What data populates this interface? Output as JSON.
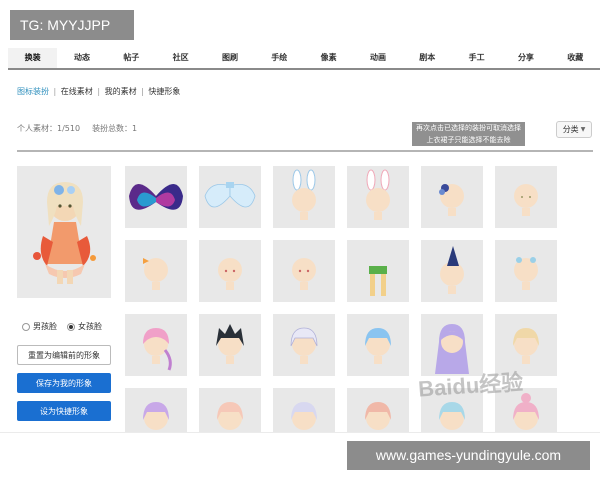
{
  "overlay": {
    "tg_label": "TG: MYYJJPP",
    "site_label": "www.games-yundingyule.com",
    "watermark_text": "Baidu经验"
  },
  "tabs": [
    {
      "label": "换装",
      "active": true
    },
    {
      "label": "动态"
    },
    {
      "label": "帖子"
    },
    {
      "label": "社区"
    },
    {
      "label": "图刷"
    },
    {
      "label": "手绘"
    },
    {
      "label": "像素"
    },
    {
      "label": "动画"
    },
    {
      "label": "剧本"
    },
    {
      "label": "手工"
    },
    {
      "label": "分享"
    },
    {
      "label": "收藏"
    }
  ],
  "subnav": {
    "items": [
      "图标装扮",
      "在线素材",
      "我的素材",
      "快捷形象"
    ],
    "separator": "|"
  },
  "stats": {
    "personal": "个人素材：1/510",
    "outfits": "装扮总数：1"
  },
  "notice": {
    "line1": "再次点击已选择的装扮可取消选择",
    "line2": "上衣裙子只能选择不能去除"
  },
  "sort": {
    "label": "分类",
    "caret": "▼"
  },
  "gender": {
    "male": "男孩脸",
    "female": "女孩脸",
    "selected": "female"
  },
  "buttons": {
    "reset": "重置为编辑前的形象",
    "save": "保存为我的形象",
    "quick": "设为快捷形象"
  },
  "grid": {
    "rows": [
      [
        "wings-dark-icon",
        "wings-light-icon",
        "bunny-ears-blue-icon",
        "bunny-ears-pink-icon",
        "hair-clip-blue-icon",
        "head-plain-icon"
      ],
      [
        "head-bow-icon",
        "head-plain-icon",
        "head-plain-icon",
        "pants-green-icon",
        "hat-navy-icon",
        "head-flower-icon"
      ],
      [
        "hair-pink-short-icon",
        "hair-black-spiky-icon",
        "hair-white-short-icon",
        "hair-blue-short-icon",
        "hair-purple-long-icon",
        "hair-blonde-short-icon"
      ],
      [
        "hair-lavender-icon",
        "hair-peach-icon",
        "hair-silver-icon",
        "hair-salmon-icon",
        "hair-teal-icon",
        "hair-pink-bun-icon"
      ]
    ]
  },
  "colors": {
    "accent_blue": "#1a6fd1",
    "link_teal": "#2e8fbd",
    "tile_bg": "#e8e8e8",
    "badge_bg": "#8c8c8c"
  }
}
